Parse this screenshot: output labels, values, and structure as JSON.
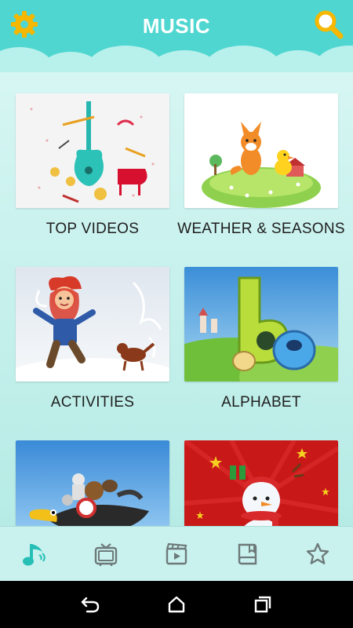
{
  "header": {
    "title": "MUSIC",
    "settings_icon": "gear-icon",
    "search_icon": "search-icon",
    "bg_color": "#4fd6d0",
    "accent_color": "#f5b700"
  },
  "categories": [
    {
      "label": "TOP VIDEOS",
      "thumb": "music-instruments"
    },
    {
      "label": "WEATHER & SEASONS",
      "thumb": "fox-and-chick"
    },
    {
      "label": "ACTIVITIES",
      "thumb": "child-in-snow"
    },
    {
      "label": "ALPHABET",
      "thumb": "letters-b-e"
    },
    {
      "label": "",
      "thumb": "animals-on-bird"
    },
    {
      "label": "",
      "thumb": "snowman"
    }
  ],
  "bottom_nav": [
    {
      "icon": "music-note-icon",
      "active": true
    },
    {
      "icon": "tv-icon",
      "active": false
    },
    {
      "icon": "video-clip-icon",
      "active": false
    },
    {
      "icon": "book-icon",
      "active": false
    },
    {
      "icon": "star-icon",
      "active": false
    }
  ],
  "system_nav": [
    {
      "icon": "back-icon"
    },
    {
      "icon": "home-icon"
    },
    {
      "icon": "recents-icon"
    }
  ]
}
